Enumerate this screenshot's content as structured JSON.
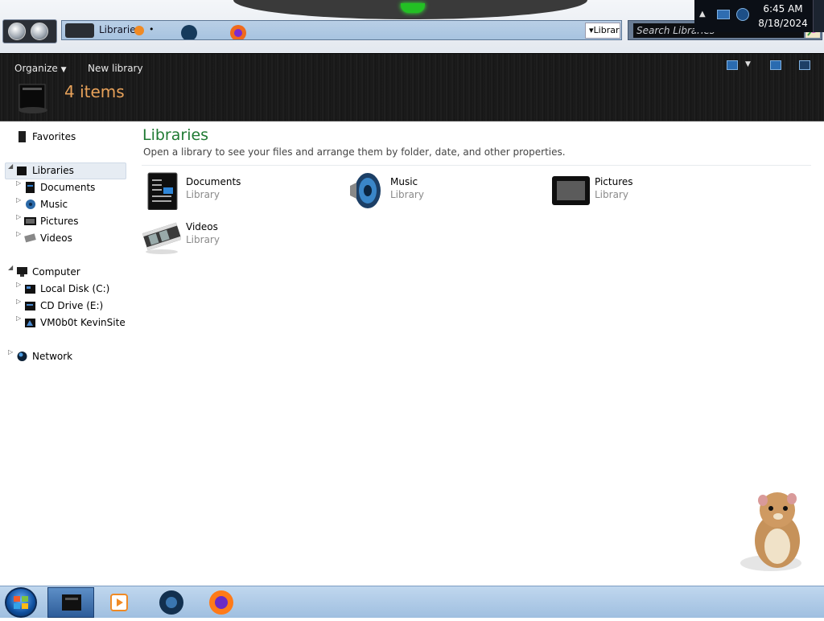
{
  "window": {
    "minimize_glyph": "_",
    "restore_glyph": "❐",
    "close_glyph": "✕"
  },
  "address_bar": {
    "path": "Libraries",
    "path_right": "Librar"
  },
  "search": {
    "placeholder": "Search Libraries"
  },
  "toolbar": {
    "organize_label": "Organize",
    "new_library_label": "New library",
    "items_count": "4 items"
  },
  "nav": {
    "favorites": "Favorites",
    "libraries": "Libraries",
    "library_children": [
      "Documents",
      "Music",
      "Pictures",
      "Videos"
    ],
    "computer": "Computer",
    "computer_children": [
      "Local Disk (C:)",
      "CD Drive (E:)",
      "VM0b0t KevinSite"
    ],
    "network": "Network"
  },
  "content": {
    "title": "Libraries",
    "subtitle": "Open a library to see your files and arrange them by folder, date, and other properties.",
    "libraries": [
      {
        "name": "Documents",
        "type": "Library",
        "icon": "documents-library-icon"
      },
      {
        "name": "Music",
        "type": "Library",
        "icon": "music-library-icon"
      },
      {
        "name": "Pictures",
        "type": "Library",
        "icon": "pictures-library-icon"
      },
      {
        "name": "Videos",
        "type": "Library",
        "icon": "videos-library-icon"
      }
    ]
  },
  "taskbar": {
    "apps": [
      "explorer",
      "media-player",
      "steam",
      "firefox"
    ],
    "time": "6:45 AM",
    "date": "8/18/2024"
  },
  "colors": {
    "title_green": "#1f7a33",
    "items_orange": "#e8a25a",
    "toolbar_dark": "#1a1a1a",
    "taskbar_blue": "#a9c7e6"
  }
}
